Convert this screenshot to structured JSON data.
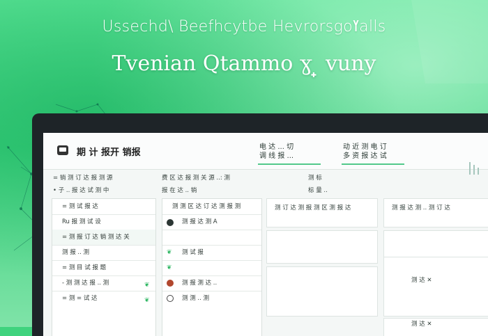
{
  "hero": {
    "line1": "Ussechd\\ Beefhcytbe Hevrorsgoߌalls",
    "line2": "Tvenian Qtammo ɣ ̟ vuny"
  },
  "app": {
    "title": "期 计 报开 销报",
    "tabs": [
      {
        "top": "电 达 ... 切",
        "bottom": "调 线 报 ..."
      },
      {
        "top": "动 近 测 电 订",
        "bottom": "多 资 报 达 试"
      }
    ]
  },
  "filters": {
    "left_1": "= 销 测 订 达 报 测 源",
    "left_2": "• 子 .. 报 达 试 测 中",
    "mid_1": "费 区 达 报 测 关 源 ..: 测",
    "mid_2": "报 在 达 .. 销",
    "right_1": "测 标",
    "right_2": "标 量 .."
  },
  "sidebar": {
    "items": [
      "= 测 试 报 达",
      "Ru 报 测 试 设",
      "= 测 报 订 达 销 测 达 关",
      "测 报 .. 测",
      "= 测 目 试 报 题",
      "- 测 测 达 报 .. 测",
      "= 测 = 试 达"
    ]
  },
  "mainlist": {
    "header": "测 测 区 达 订 达 测 报 测",
    "items": [
      "测 报 达 测 A",
      "测 试 报",
      "测 报 测 达 ..",
      "测 测 .. 测"
    ]
  },
  "grid": {
    "col1_header": "测 订 达 测 报 测 区 测 报 达",
    "col2_header": "测 报 达 测 .. 测 订 达",
    "row3_text": "测 达 ✕",
    "bottom_text": "测 达 ✕"
  },
  "colors": {
    "accent": "#3fd37e",
    "frame": "#1e2428"
  }
}
